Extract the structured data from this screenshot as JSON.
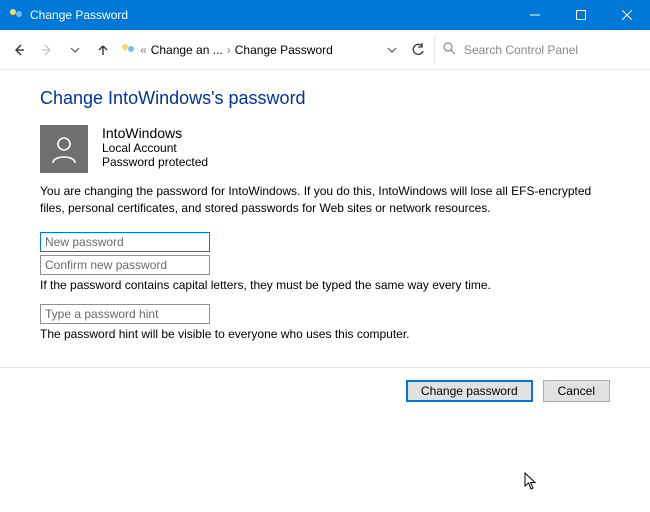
{
  "window": {
    "title": "Change Password"
  },
  "breadcrumb": {
    "item1": "Change an ...",
    "item2": "Change Password"
  },
  "search": {
    "placeholder": "Search Control Panel"
  },
  "page": {
    "heading": "Change IntoWindows's password"
  },
  "user": {
    "name": "IntoWindows",
    "account_type": "Local Account",
    "status": "Password protected"
  },
  "warning_text": "You are changing the password for IntoWindows.  If you do this, IntoWindows will lose all EFS-encrypted files, personal certificates, and stored passwords for Web sites or network resources.",
  "fields": {
    "new_password_placeholder": "New password",
    "confirm_password_placeholder": "Confirm new password",
    "caps_note": "If the password contains capital letters, they must be typed the same way every time.",
    "hint_placeholder": "Type a password hint",
    "hint_note": "The password hint will be visible to everyone who uses this computer."
  },
  "buttons": {
    "change": "Change password",
    "cancel": "Cancel"
  }
}
